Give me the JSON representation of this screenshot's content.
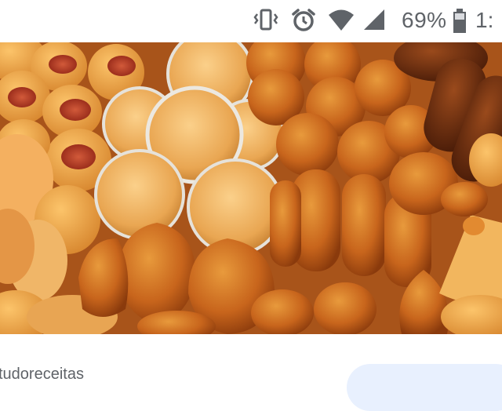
{
  "status_bar": {
    "battery_percent": "69%",
    "clock": "1:",
    "icons": [
      "vibrate-icon",
      "alarm-icon",
      "wifi-icon",
      "cell-signal-icon",
      "battery-icon"
    ]
  },
  "image_result": {
    "source": "tudoreceitas"
  },
  "colors": {
    "status_icon": "#5f6368",
    "chip_background": "#e8f0fe",
    "text_secondary": "#5f6368"
  }
}
